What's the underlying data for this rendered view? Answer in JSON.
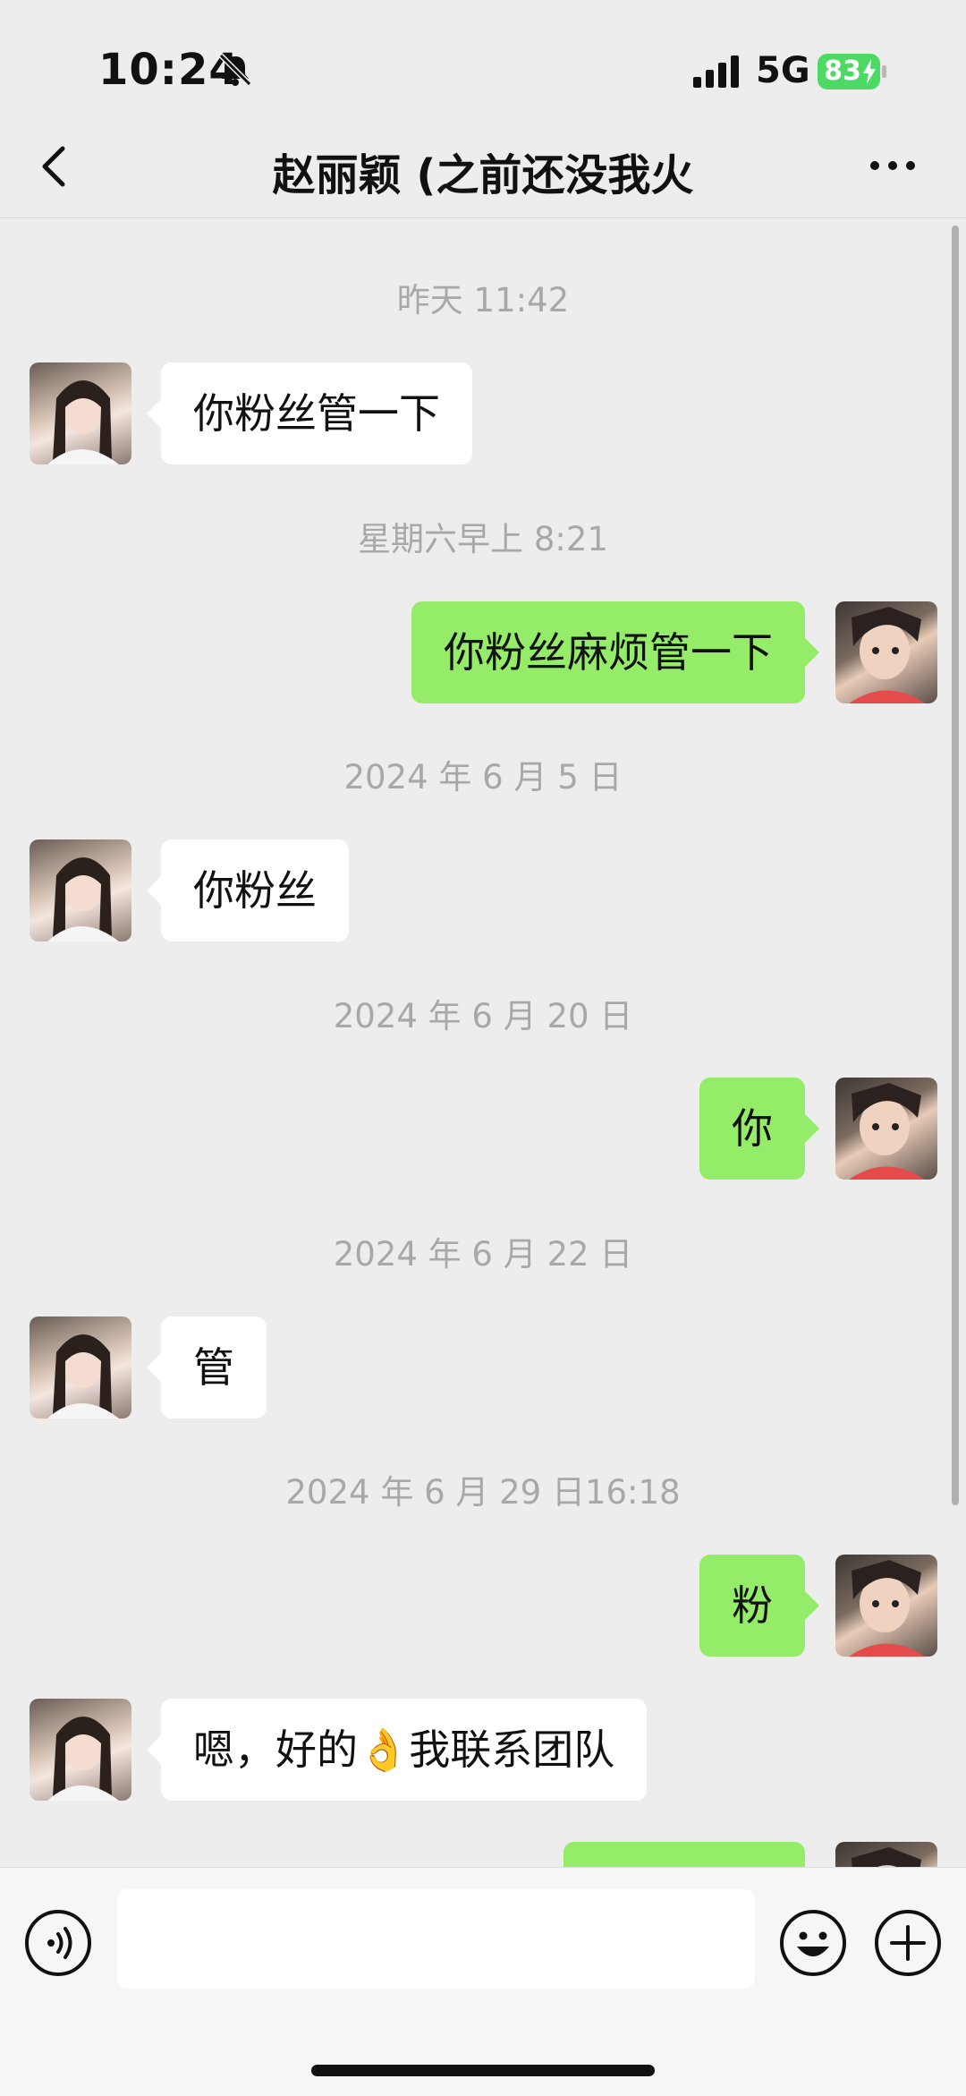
{
  "status_bar": {
    "time": "10:24",
    "network": "5G",
    "battery": "83"
  },
  "nav": {
    "title": "赵丽颖 (之前还没我火"
  },
  "messages": [
    {
      "timestamp": "昨天 11:42"
    },
    {
      "side": "left",
      "text": "你粉丝管一下"
    },
    {
      "timestamp": "星期六早上 8:21"
    },
    {
      "side": "right",
      "text": "你粉丝麻烦管一下"
    },
    {
      "timestamp": "2024 年 6 月 5 日"
    },
    {
      "side": "left",
      "text": "你粉丝"
    },
    {
      "timestamp": "2024 年 6 月 20 日"
    },
    {
      "side": "right",
      "text": "你"
    },
    {
      "timestamp": "2024 年 6 月 22 日"
    },
    {
      "side": "left",
      "text": "管"
    },
    {
      "timestamp": "2024 年 6 月 29 日16:18"
    },
    {
      "side": "right",
      "text": "粉"
    },
    {
      "side": "left",
      "text": "嗯，好的👌我联系团队"
    },
    {
      "side": "right",
      "text": ""
    }
  ],
  "colors": {
    "background": "#ededed",
    "bubble_right": "#95ec69",
    "bubble_left": "#ffffff",
    "battery": "#4cd964"
  },
  "icons": [
    "back-arrow-icon",
    "more-icon",
    "voice-icon",
    "emoji-icon",
    "plus-icon",
    "bell-muted-icon",
    "signal-icon",
    "bolt-icon"
  ]
}
